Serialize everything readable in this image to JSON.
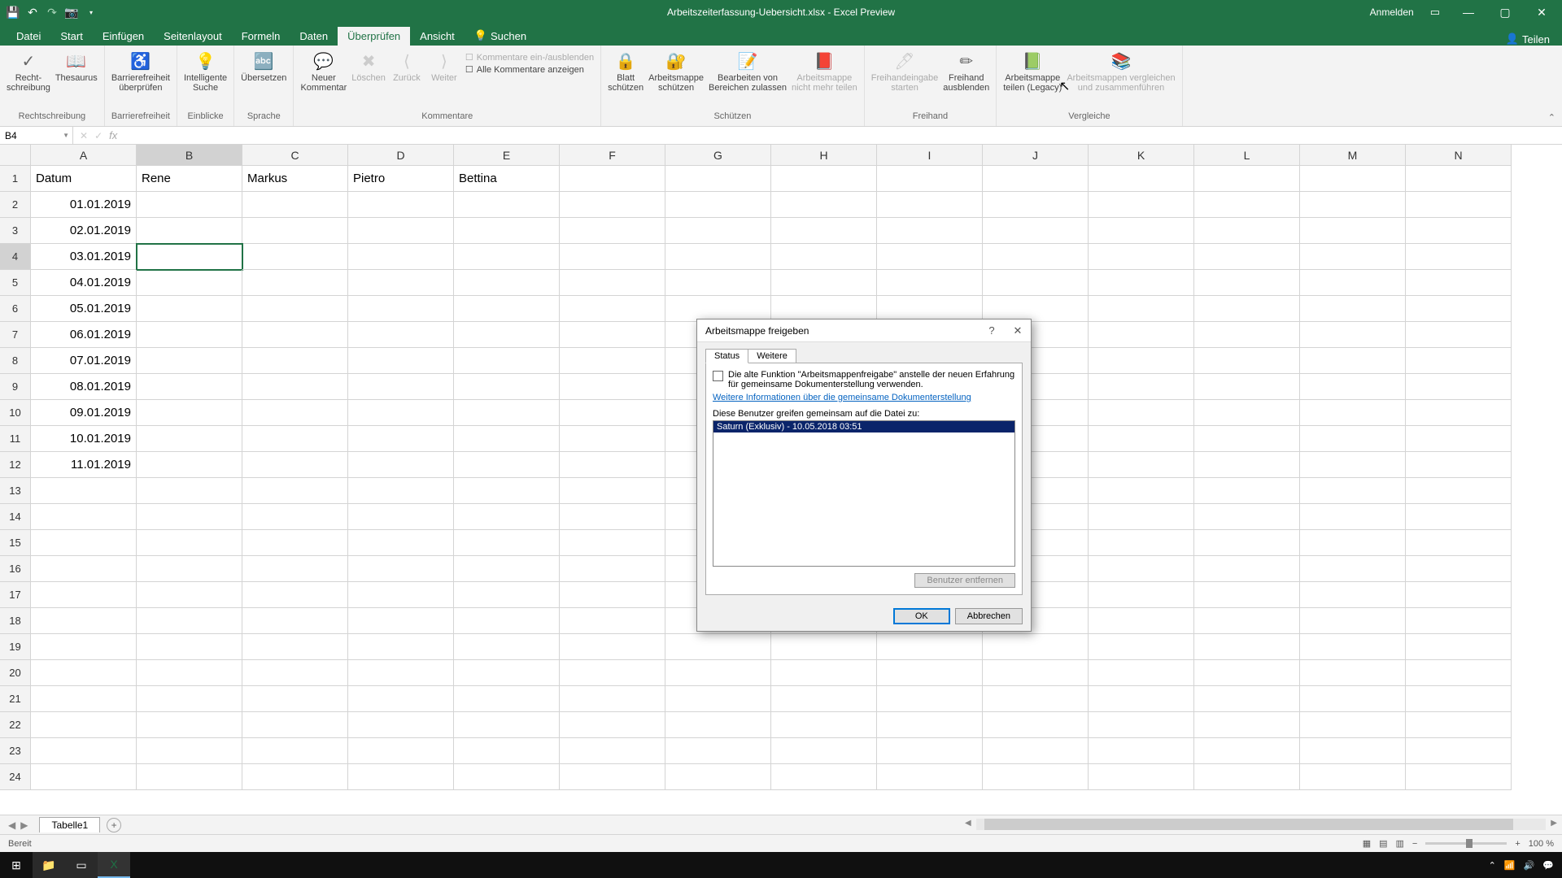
{
  "titlebar": {
    "document_title": "Arbeitszeiterfassung-Uebersicht.xlsx  -  Excel Preview",
    "signin": "Anmelden"
  },
  "menu": {
    "tabs": [
      "Datei",
      "Start",
      "Einfügen",
      "Seitenlayout",
      "Formeln",
      "Daten",
      "Überprüfen",
      "Ansicht"
    ],
    "active_index": 6,
    "search": "Suchen",
    "share": "Teilen"
  },
  "ribbon": {
    "groups": {
      "rechtschreibung": {
        "label": "Rechtschreibung",
        "items": [
          "Recht-\nschreibung",
          "Thesaurus"
        ]
      },
      "barrierefreiheit": {
        "label": "Barrierefreiheit",
        "items": [
          "Barrierefreiheit\nüberprüfen"
        ]
      },
      "einblicke": {
        "label": "Einblicke",
        "items": [
          "Intelligente\nSuche"
        ]
      },
      "sprache": {
        "label": "Sprache",
        "items": [
          "Übersetzen"
        ]
      },
      "kommentare": {
        "label": "Kommentare",
        "items": [
          "Neuer\nKommentar",
          "Löschen",
          "Zurück",
          "Weiter"
        ],
        "small": [
          "Kommentare ein-/ausblenden",
          "Alle Kommentare anzeigen"
        ]
      },
      "schuetzen": {
        "label": "Schützen",
        "items": [
          "Blatt\nschützen",
          "Arbeitsmappe\nschützen",
          "Bearbeiten von\nBereichen zulassen",
          "Arbeitsmappe\nnicht mehr teilen"
        ]
      },
      "freihand": {
        "label": "Freihand",
        "items": [
          "Freihandeingabe\nstarten",
          "Freihand\nausblenden"
        ]
      },
      "vergleiche": {
        "label": "Vergleiche",
        "items": [
          "Arbeitsmappe\nteilen (Legacy)",
          "Arbeitsmappen vergleichen\nund zusammenführen"
        ]
      }
    }
  },
  "namebox": "B4",
  "columns": [
    "A",
    "B",
    "C",
    "D",
    "E",
    "F",
    "G",
    "H",
    "I",
    "J",
    "K",
    "L",
    "M",
    "N"
  ],
  "headers": {
    "A": "Datum",
    "B": "Rene",
    "C": "Markus",
    "D": "Pietro",
    "E": "Bettina"
  },
  "dates": [
    "01.01.2019",
    "02.01.2019",
    "03.01.2019",
    "04.01.2019",
    "05.01.2019",
    "06.01.2019",
    "07.01.2019",
    "08.01.2019",
    "09.01.2019",
    "10.01.2019",
    "11.01.2019"
  ],
  "active_cell": {
    "row": 4,
    "col": "B"
  },
  "sheet_tabs": {
    "active": "Tabelle1"
  },
  "status": {
    "ready": "Bereit",
    "zoom": "100 %"
  },
  "dialog": {
    "title": "Arbeitsmappe freigeben",
    "tabs": [
      "Status",
      "Weitere"
    ],
    "check_text": "Die alte Funktion \"Arbeitsmappenfreigabe\" anstelle der neuen Erfahrung für gemeinsame Dokumenterstellung verwenden.",
    "link": "Weitere Informationen über die gemeinsame Dokumenterstellung",
    "list_label": "Diese Benutzer greifen gemeinsam auf die Datei zu:",
    "list_item": "Saturn (Exklusiv) - 10.05.2018 03:51",
    "remove_user": "Benutzer entfernen",
    "ok": "OK",
    "cancel": "Abbrechen"
  },
  "taskbar": {
    "time": "",
    "icons": [
      "start",
      "search",
      "taskview",
      "explorer",
      "excel"
    ]
  }
}
